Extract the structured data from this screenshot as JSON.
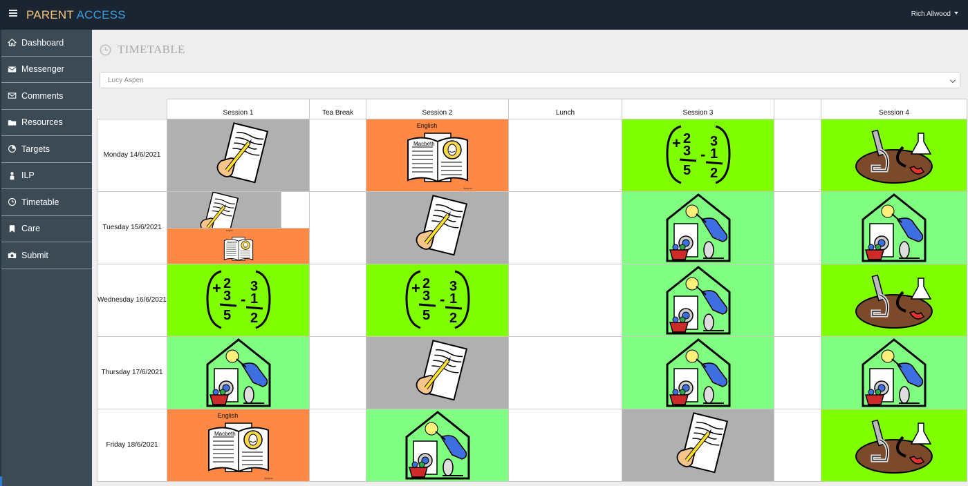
{
  "app": {
    "brand_part1": "PARENT",
    "brand_part2": "ACCESS",
    "user_name": "Rich Allwood"
  },
  "sidebar": {
    "items": [
      {
        "label": "Dashboard",
        "icon": "home-icon"
      },
      {
        "label": "Messenger",
        "icon": "envelope-icon"
      },
      {
        "label": "Comments",
        "icon": "mail-outline-icon"
      },
      {
        "label": "Resources",
        "icon": "folder-icon"
      },
      {
        "label": "Targets",
        "icon": "pie-chart-icon"
      },
      {
        "label": "ILP",
        "icon": "person-icon"
      },
      {
        "label": "Timetable",
        "icon": "clock-icon"
      },
      {
        "label": "Care",
        "icon": "bookmark-icon"
      },
      {
        "label": "Submit",
        "icon": "camera-icon"
      }
    ]
  },
  "page": {
    "title": "TIMETABLE",
    "student_select": "Lucy Aspen"
  },
  "timetable": {
    "headers": [
      "Session 1",
      "Tea Break",
      "Session 2",
      "Lunch",
      "Session 3",
      "",
      "Session 4"
    ],
    "days": [
      "Monday 14/6/2021",
      "Tuesday 15/6/2021",
      "Wednesday 16/6/2021",
      "Thursday 17/6/2021",
      "Friday 18/6/2021"
    ],
    "english_label": "English",
    "book_label": "Macbeth",
    "book_tiny": "Apsyros",
    "colors": {
      "writing": "#b0b0b0",
      "english": "#ff8844",
      "maths": "#80ff00",
      "science": "#80ff00",
      "life_skills": "#80ff80"
    }
  }
}
